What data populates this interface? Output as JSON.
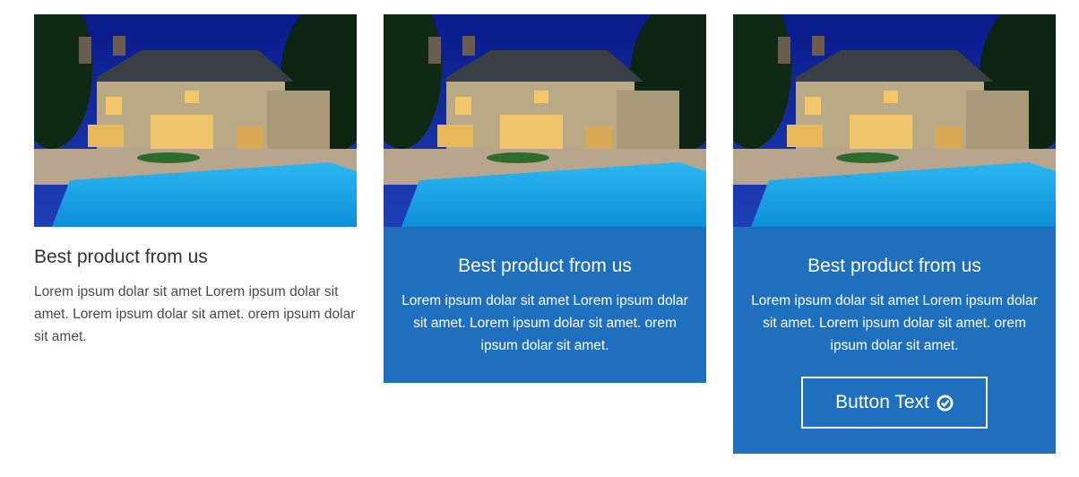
{
  "cards": [
    {
      "title": "Best product from us",
      "text": "Lorem ipsum dolar sit amet Lorem ipsum dolar sit amet. Lorem ipsum dolar sit amet. orem ipsum dolar sit amet."
    },
    {
      "title": "Best product from us",
      "text": "Lorem ipsum dolar sit amet Lorem ipsum dolar sit amet. Lorem ipsum dolar sit amet. orem ipsum dolar sit amet."
    },
    {
      "title": "Best product from us",
      "text": "Lorem ipsum dolar sit amet Lorem ipsum dolar sit amet. Lorem ipsum dolar sit amet. orem ipsum dolar sit amet.",
      "button_label": "Button Text",
      "button_icon": "check-circle-icon"
    }
  ],
  "colors": {
    "accent_blue": "#1f6fbf",
    "text_dark": "#333333",
    "white": "#ffffff"
  }
}
